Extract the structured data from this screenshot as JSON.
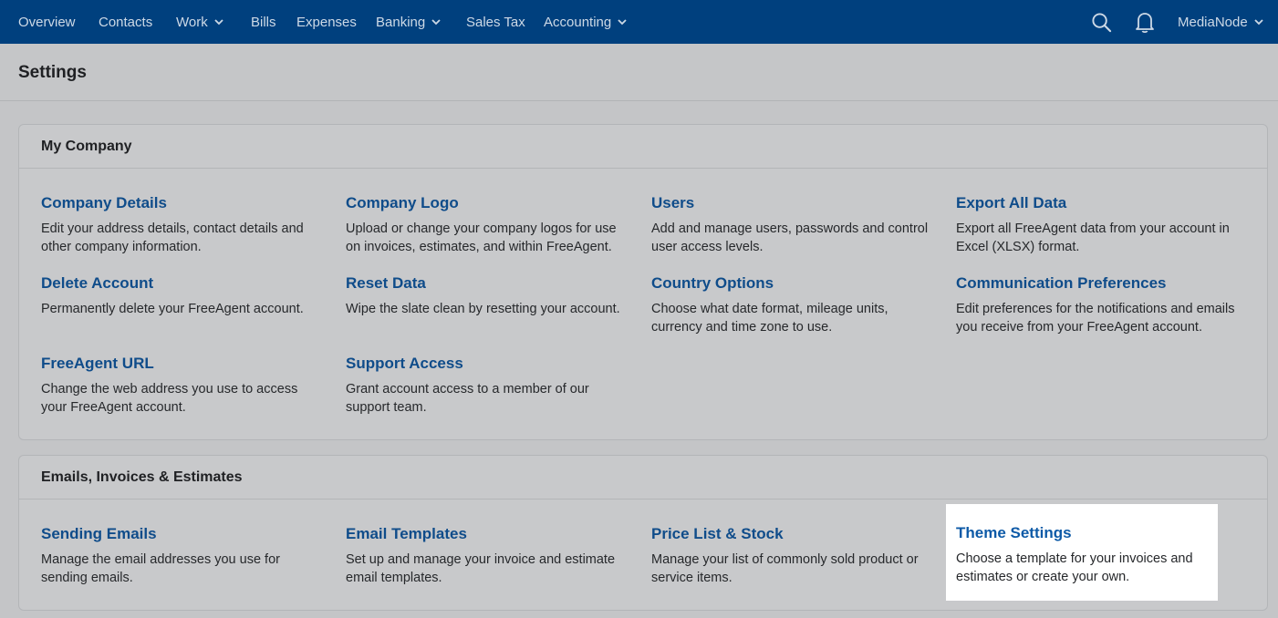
{
  "nav": {
    "items": [
      {
        "label": "Overview",
        "dropdown": false
      },
      {
        "label": "Contacts",
        "dropdown": false
      },
      {
        "label": "Work",
        "dropdown": true
      },
      {
        "label": "Bills",
        "dropdown": false
      },
      {
        "label": "Expenses",
        "dropdown": false
      },
      {
        "label": "Banking",
        "dropdown": true
      },
      {
        "label": "Sales Tax",
        "dropdown": false
      },
      {
        "label": "Accounting",
        "dropdown": true
      }
    ],
    "account_label": "MediaNode",
    "icons": {
      "search": "search-icon",
      "notifications": "bell-icon",
      "account_menu": "chevron-down-icon"
    }
  },
  "page": {
    "title": "Settings"
  },
  "sections": [
    {
      "title": "My Company",
      "items": [
        {
          "title": "Company Details",
          "desc": "Edit your address details, contact details and other company information."
        },
        {
          "title": "Company Logo",
          "desc": "Upload or change your company logos for use on invoices, estimates, and within FreeAgent."
        },
        {
          "title": "Users",
          "desc": "Add and manage users, passwords and control user access levels."
        },
        {
          "title": "Export All Data",
          "desc": "Export all FreeAgent data from your account in Excel (XLSX) format."
        },
        {
          "title": "Delete Account",
          "desc": "Permanently delete your FreeAgent account."
        },
        {
          "title": "Reset Data",
          "desc": "Wipe the slate clean by resetting your account."
        },
        {
          "title": "Country Options",
          "desc": "Choose what date format, mileage units, currency and time zone to use."
        },
        {
          "title": "Communication Preferences",
          "desc": "Edit preferences for the notifications and emails you receive from your FreeAgent account."
        },
        {
          "title": "FreeAgent URL",
          "desc": "Change the web address you use to access your FreeAgent account."
        },
        {
          "title": "Support Access",
          "desc": "Grant account access to a member of our support team."
        }
      ]
    },
    {
      "title": "Emails, Invoices & Estimates",
      "items": [
        {
          "title": "Sending Emails",
          "desc": "Manage the email addresses you use for sending emails."
        },
        {
          "title": "Email Templates",
          "desc": "Set up and manage your invoice and estimate email templates."
        },
        {
          "title": "Price List & Stock",
          "desc": "Manage your list of commonly sold product or service items."
        },
        {
          "title": "Theme Settings",
          "desc": "Choose a template for your invoices and estimates or create your own."
        }
      ]
    }
  ],
  "colors": {
    "nav_bg": "#00407e",
    "link": "#0f4c8a",
    "highlight_bg": "#ffffff"
  }
}
